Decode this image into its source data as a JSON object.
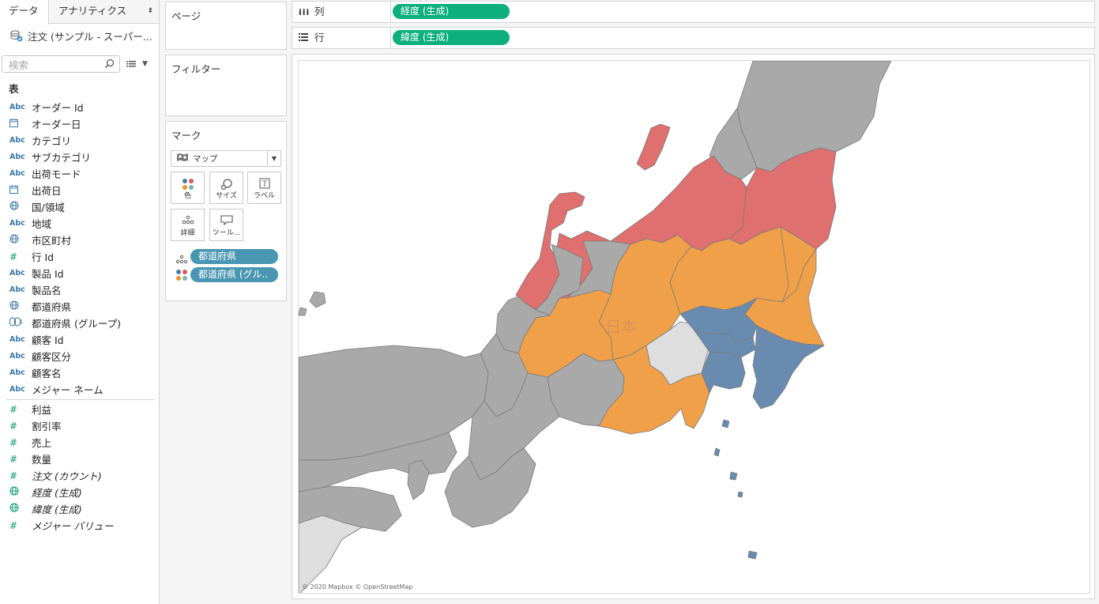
{
  "data_pane": {
    "tabs": [
      {
        "label": "データ"
      },
      {
        "label": "アナリティクス"
      }
    ],
    "datasource": "注文 (サンプル - スーパー...",
    "search_placeholder": "検索",
    "tables_header": "表",
    "dimensions": [
      {
        "type": "abc",
        "name": "オーダー Id"
      },
      {
        "type": "cal",
        "name": "オーダー日"
      },
      {
        "type": "abc",
        "name": "カテゴリ"
      },
      {
        "type": "abc",
        "name": "サブカテゴリ"
      },
      {
        "type": "abc",
        "name": "出荷モード"
      },
      {
        "type": "cal",
        "name": "出荷日"
      },
      {
        "type": "geo",
        "name": "国/領域"
      },
      {
        "type": "abc",
        "name": "地域"
      },
      {
        "type": "geo",
        "name": "市区町村"
      },
      {
        "type": "num-d",
        "name": "行 Id"
      },
      {
        "type": "abc",
        "name": "製品 Id"
      },
      {
        "type": "abc",
        "name": "製品名"
      },
      {
        "type": "geo",
        "name": "都道府県"
      },
      {
        "type": "grp",
        "name": "都道府県 (グループ)"
      },
      {
        "type": "abc",
        "name": "顧客 Id"
      },
      {
        "type": "abc",
        "name": "顧客区分"
      },
      {
        "type": "abc",
        "name": "顧客名"
      },
      {
        "type": "abc",
        "name": "メジャー ネーム"
      }
    ],
    "measures": [
      {
        "type": "num",
        "name": "利益"
      },
      {
        "type": "num",
        "name": "割引率"
      },
      {
        "type": "num",
        "name": "売上"
      },
      {
        "type": "num",
        "name": "数量"
      },
      {
        "type": "num",
        "name": "注文 (カウント)"
      },
      {
        "type": "geo-m",
        "name": "経度 (生成)"
      },
      {
        "type": "geo-m",
        "name": "緯度 (生成)"
      },
      {
        "type": "num",
        "name": "メジャー バリュー"
      }
    ]
  },
  "cards": {
    "pages_title": "ページ",
    "filters_title": "フィルター",
    "marks_title": "マーク",
    "mark_type": "マップ",
    "buttons": {
      "color": "色",
      "size": "サイズ",
      "label": "ラベル",
      "detail": "詳細",
      "tooltip": "ツール..."
    },
    "mark_pills": [
      "都道府県",
      "都道府県 (グル.."
    ]
  },
  "shelves": {
    "columns_label": "列",
    "columns_pill": "経度 (生成)",
    "rows_label": "行",
    "rows_pill": "緯度 (生成)"
  },
  "map": {
    "country_label": "日本",
    "attribution": "© 2020 Mapbox © OpenStreetMap",
    "colors": {
      "red": "#e06f6f",
      "orange": "#f1a04a",
      "blue": "#6a8bb0",
      "gray": "#a9a9a9",
      "light": "#dedede"
    }
  }
}
